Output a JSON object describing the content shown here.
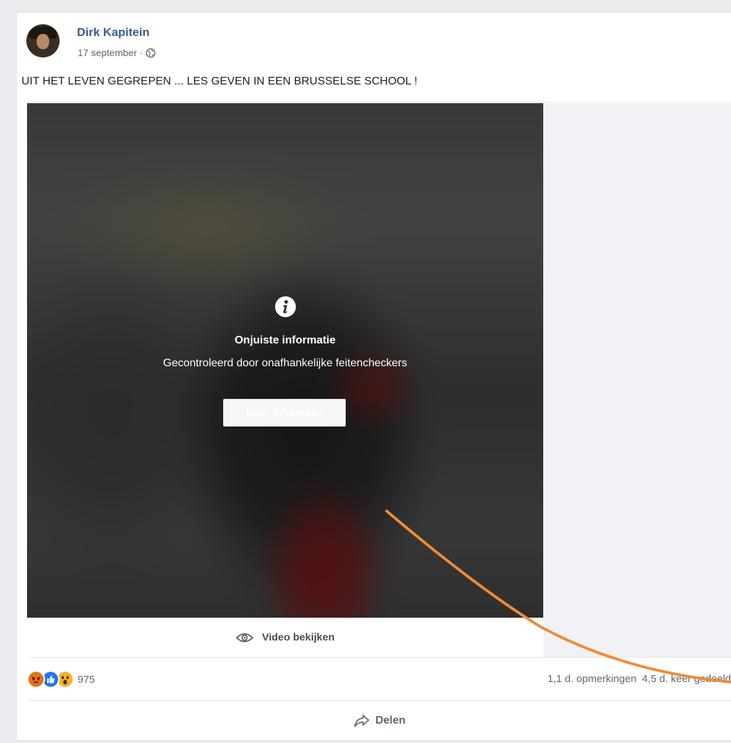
{
  "post": {
    "author": "Dirk Kapitein",
    "date": "17 september",
    "date_separator": "·",
    "privacy_icon": "globe-icon",
    "text": "UIT HET LEVEN GEGREPEN ... LES GEVEN IN EEN BRUSSELSE SCHOOL !"
  },
  "video": {
    "warning_icon": "info-icon",
    "warning_title": "Onjuiste informatie",
    "warning_subtitle": "Gecontroleerd door onafhankelijke feitencheckers",
    "more_info_label": "Meer informatie",
    "watch_label": "Video bekijken",
    "watch_icon": "eye-icon"
  },
  "engagement": {
    "reactions": [
      "angry",
      "like",
      "wow"
    ],
    "reaction_count": "975",
    "comments": "1,1 d. opmerkingen",
    "shares": "4,5 d. keer gedeeld"
  },
  "actions": {
    "share_label": "Delen",
    "share_icon": "share-arrow-icon"
  },
  "colors": {
    "author_link": "#385898",
    "annotation_arrow": "#f08a35",
    "angry": "#e9710f",
    "like": "#2078f4",
    "wow": "#f7b125"
  }
}
